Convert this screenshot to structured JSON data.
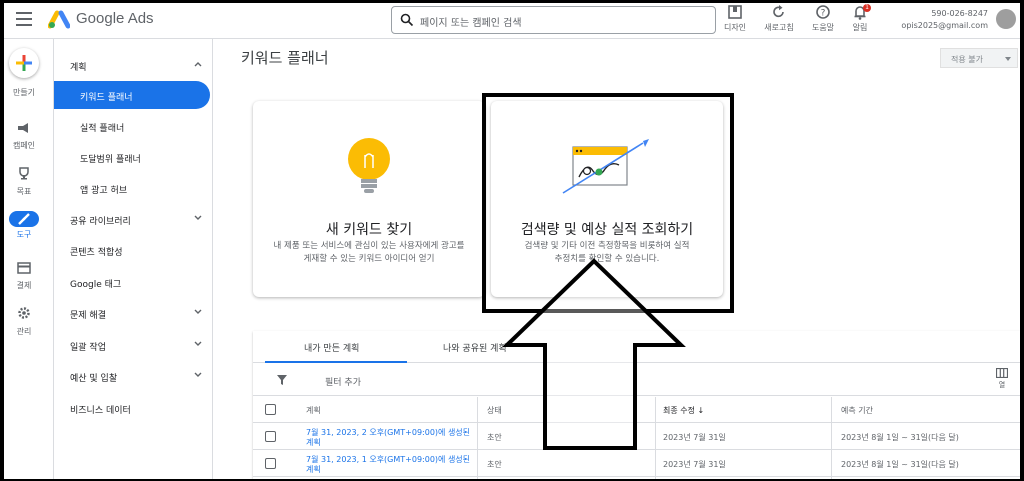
{
  "header": {
    "brand": "Google Ads",
    "search_placeholder": "페이지 또는 캠페인 검색",
    "buttons": [
      {
        "label": "디자인",
        "icon": "design-icon"
      },
      {
        "label": "새로고침",
        "icon": "refresh-icon"
      },
      {
        "label": "도움말",
        "icon": "help-icon"
      },
      {
        "label": "알림",
        "icon": "bell-icon",
        "badge": "1"
      }
    ],
    "account_id": "590-026-8247",
    "account_email": "opis2025@gmail.com"
  },
  "rail": {
    "create": "만들기",
    "campaign": "캠페인",
    "goals": "목표",
    "tools": "도구",
    "billing": "결제",
    "admin": "관리"
  },
  "nav": {
    "planning": "계획",
    "keyword_planner": "키워드 플래너",
    "performance_planner": "실적 플래너",
    "reach_planner": "도달범위 플래너",
    "app_hub": "앱 광고 허브",
    "shared_library": "공유 라이브러리",
    "content_suitability": "콘텐츠 적합성",
    "google_tag": "Google 태그",
    "troubleshooting": "문제 해결",
    "bulk_actions": "일괄 작업",
    "budgets_bidding": "예산 및 입찰",
    "business_data": "비즈니스 데이터"
  },
  "main": {
    "title": "키워드 플래너",
    "apply_button": "적용 불가",
    "card_discover": {
      "title": "새 키워드 찾기",
      "desc": "내 제품 또는 서비스에 관심이 있는 사용자에게 광고를 게재할 수 있는 키워드 아이디어 얻기"
    },
    "card_volume": {
      "title": "검색량 및 예상 실적 조회하기",
      "desc_line1": "검색량 및 기타 이전 측정항목을 비롯하여 실적",
      "desc_line2": "추정치를 확인할 수 있습니다."
    },
    "tabs": [
      "내가 만든 계획",
      "나와 공유된 계획"
    ],
    "filter_label": "필터 추가",
    "columns_label": "열",
    "table": {
      "headers": [
        "계획",
        "상태",
        "최종 수정 ↓",
        "예측 기간"
      ],
      "rows": [
        {
          "plan_line1": "7월 31, 2023, 2 오후(GMT+09:00)에 생성된",
          "plan_line2": "계획",
          "status": "초안",
          "modified": "2023년 7월 31일",
          "period": "2023년 8월 1일 ~ 31일(다음 달)"
        },
        {
          "plan_line1": "7월 31, 2023, 1 오후(GMT+09:00)에 생성된",
          "plan_line2": "계획",
          "status": "초안",
          "modified": "2023년 7월 31일",
          "period": "2023년 8월 1일 ~ 31일(다음 달)"
        }
      ]
    }
  },
  "colors": {
    "accent": "#1a73e8",
    "bulb": "#fbbc04",
    "chart_header": "#fbbc04",
    "point": "#34a853",
    "notification": "#d93025"
  }
}
